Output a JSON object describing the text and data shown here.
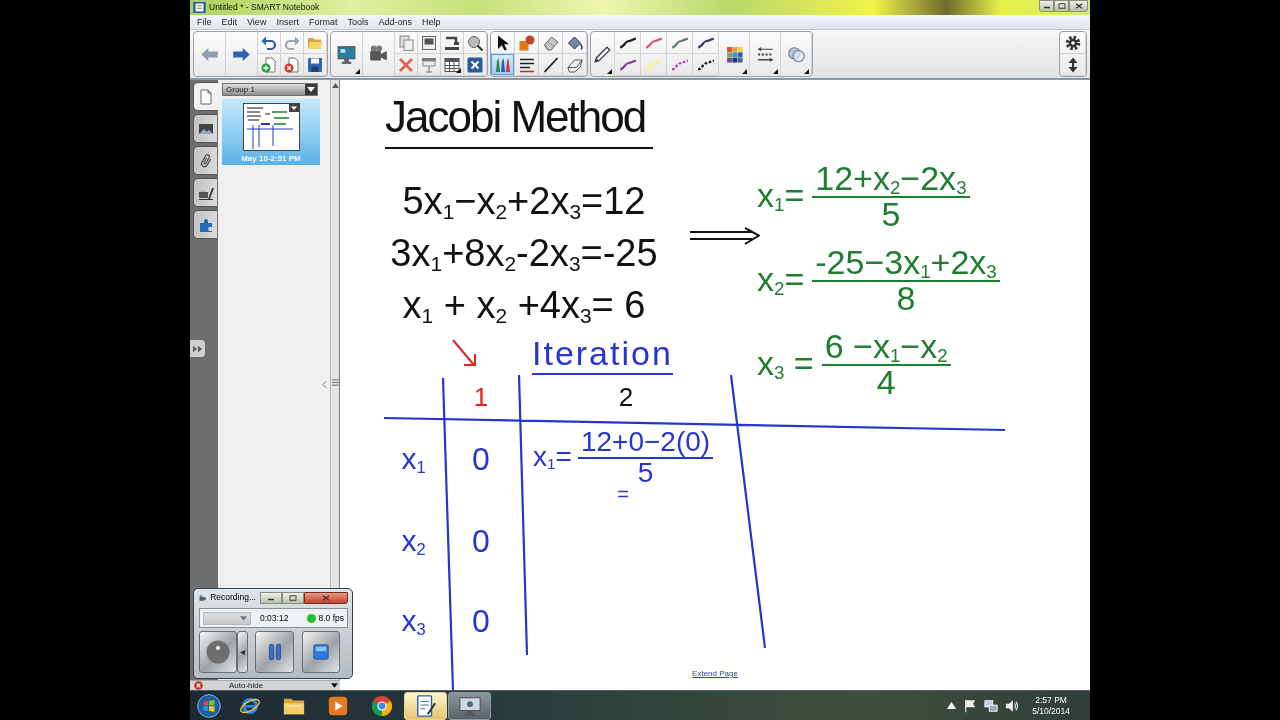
{
  "window": {
    "title": "Untitled * - SMART Notebook"
  },
  "menu": [
    "File",
    "Edit",
    "View",
    "Insert",
    "Format",
    "Tools",
    "Add-ons",
    "Help"
  ],
  "toolbar": {
    "tools": [
      {
        "kind": "select",
        "selected": false
      },
      {
        "kind": "shapes",
        "selected": false
      },
      {
        "kind": "eraser",
        "selected": false
      },
      {
        "kind": "fill",
        "selected": false
      },
      {
        "kind": "pens",
        "selected": true
      },
      {
        "kind": "text",
        "selected": false
      },
      {
        "kind": "line",
        "selected": false
      },
      {
        "kind": "shape-eraser",
        "selected": false
      }
    ],
    "pen_styles": [
      {
        "kind": "solid",
        "color": "#1a1a1a"
      },
      {
        "kind": "solid",
        "color": "#d4587e"
      },
      {
        "kind": "solid",
        "color": "#5f7f6c"
      },
      {
        "kind": "solid",
        "color": "#3d3d5c"
      },
      {
        "kind": "solid",
        "color": "#8c3c8c"
      },
      {
        "kind": "highlighter",
        "color": "#f3f1a6"
      },
      {
        "kind": "dashed",
        "color": "#e020d0"
      },
      {
        "kind": "dashed",
        "color": "#111111"
      }
    ]
  },
  "side_panel": {
    "tabs": [
      {
        "kind": "page-sorter",
        "selected": true
      },
      {
        "kind": "gallery",
        "selected": false
      },
      {
        "kind": "attachments",
        "selected": false
      },
      {
        "kind": "properties",
        "selected": false
      },
      {
        "kind": "add-ons",
        "selected": false
      }
    ],
    "group": "Group 1",
    "pages": [
      {
        "label": "May 10-2:51 PM",
        "selected": true
      }
    ],
    "auto_hide": "Auto-hide"
  },
  "canvas": {
    "title": "Jacobi Method",
    "equations": [
      "5x$_{1}$−x$_{2}$+2x$_{3}$=12",
      "3x$_{1}$+8x$_{2}$-2x$_{3}$=-25",
      "x$_{1}$ + x$_{2}$ +4x$_{3}$= 6"
    ],
    "solved": [
      {
        "lhs": "x$_{1}$=",
        "numerator": "12+x$_{2}$−2x$_{3}$",
        "denominator": "5"
      },
      {
        "lhs": "x$_{2}$=",
        "numerator": "-25−3x$_{1}$+2x$_{3}$",
        "denominator": "8"
      },
      {
        "lhs": "x$_{3}$ =",
        "numerator": "6 −x$_{1}$−x$_{2}$",
        "denominator": "4"
      }
    ],
    "iteration_label": "Iteration",
    "table": {
      "columns": [
        {
          "label": "1",
          "color": "#e3231f"
        },
        {
          "label": "2",
          "color": "#111111"
        }
      ],
      "rows": [
        {
          "label": "x$_{1}$",
          "cells": [
            {
              "kind": "value",
              "text": "0"
            },
            {
              "kind": "fraction",
              "lhs": "x$_{1}$=",
              "numerator": "12+0−2(0)",
              "denominator": "5",
              "continuation": "="
            }
          ]
        },
        {
          "label": "x$_{2}$",
          "cells": [
            {
              "kind": "value",
              "text": "0"
            }
          ]
        },
        {
          "label": "x$_{3}$",
          "cells": [
            {
              "kind": "value",
              "text": "0"
            }
          ]
        }
      ]
    },
    "extend_link": "Extend Page"
  },
  "recorder": {
    "title": "Recording...",
    "dropdown": {
      "disabled": true
    },
    "elapsed": "0:03:12",
    "status_dot": {
      "color": "#22c322"
    },
    "frame_rate": "8.0 fps"
  },
  "taskbar": {
    "apps": [
      {
        "kind": "browser",
        "running": false,
        "selected": false
      },
      {
        "kind": "folder",
        "running": false,
        "selected": false
      },
      {
        "kind": "player",
        "running": false,
        "selected": false
      },
      {
        "kind": "web",
        "running": false,
        "selected": false
      },
      {
        "kind": "notebook",
        "running": true,
        "selected": true
      },
      {
        "kind": "recorder",
        "running": true,
        "selected": false
      }
    ],
    "time": "2:57 PM",
    "date": "5/10/2014"
  }
}
